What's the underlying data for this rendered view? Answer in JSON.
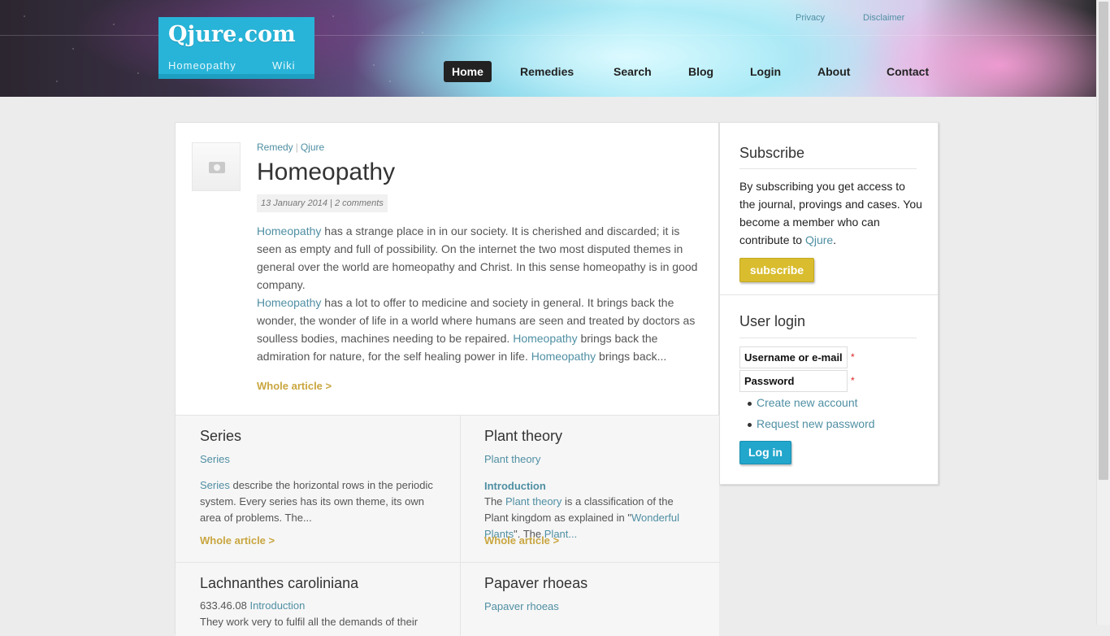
{
  "header": {
    "logo_title": "Qjure.com",
    "logo_sub_left": "Homeopathy",
    "logo_sub_right": "Wiki",
    "utility_links": [
      "Privacy",
      "Disclaimer"
    ],
    "nav": [
      "Home",
      "Remedies",
      "Search",
      "Blog",
      "Login",
      "About",
      "Contact"
    ],
    "active_nav": "Home"
  },
  "article": {
    "breadcrumb": [
      "Remedy",
      "Qjure"
    ],
    "title": "Homeopathy",
    "date": "13 January 2014",
    "comments": "2 comments",
    "p1_link": "Homeopathy",
    "p1_text": " has a strange place in in our society. It is cherished and discarded; it is seen as empty and full of possibility. On the internet the two most disputed themes in general over the world are homeopathy and Christ. In this sense homeopathy is in good company.",
    "p2_link1": "Homeopathy",
    "p2_text1": " has a lot to offer to medicine and society in general. It brings back the wonder, the wonder of life in a world where humans are seen and treated by doctors as soulless bodies, machines needing to be repaired. ",
    "p2_link2": "Homeopathy",
    "p2_text2": " brings back the admiration for nature, for the self healing power in life. ",
    "p2_link3": "Homeopathy",
    "p2_text3": " brings back...",
    "read_more": "Whole article >"
  },
  "teasers": [
    {
      "title": "Series",
      "subtitle": "Series",
      "text_link": "Series",
      "text": " describe the horizontal rows in the periodic system. Every series has its own theme, its own area of problems. The...",
      "read_more": "Whole article >"
    },
    {
      "title": "Plant theory",
      "subtitle": "Plant theory",
      "heading": "Introduction",
      "text_pre": "The ",
      "text_link1": "Plant theory",
      "text_mid": " is a classification of the Plant kingdom as explained in \"",
      "text_link2": "Wonderful Plants",
      "text_mid2": "\". The ",
      "text_link3": "Plant...",
      "read_more": "Whole article >"
    },
    {
      "title": "Lachnanthes caroliniana",
      "code": "633.46.08 ",
      "code_link": "Introduction",
      "text": "They work very to fulfil all the demands of their"
    },
    {
      "title": "Papaver rhoeas",
      "subtitle": "Papaver rhoeas"
    }
  ],
  "sidebar": {
    "subscribe_title": "Subscribe",
    "subscribe_text": "By subscribing you get access to the journal, provings and cases. You become a member who can contribute to ",
    "subscribe_link": "Qjure",
    "subscribe_text_end": ".",
    "subscribe_button": "subscribe",
    "login_title": "User login",
    "username_placeholder": "Username or e-mail",
    "password_placeholder": "Password",
    "required_mark": "*",
    "create_account": "Create new account",
    "request_password": "Request new password",
    "login_button": "Log in"
  },
  "colors": {
    "accent": "#28b4d8",
    "link": "#4f8fa3",
    "gold": "#c9a640",
    "subscribe_button": "#d9bd2e",
    "login_button": "#22a6cc"
  }
}
